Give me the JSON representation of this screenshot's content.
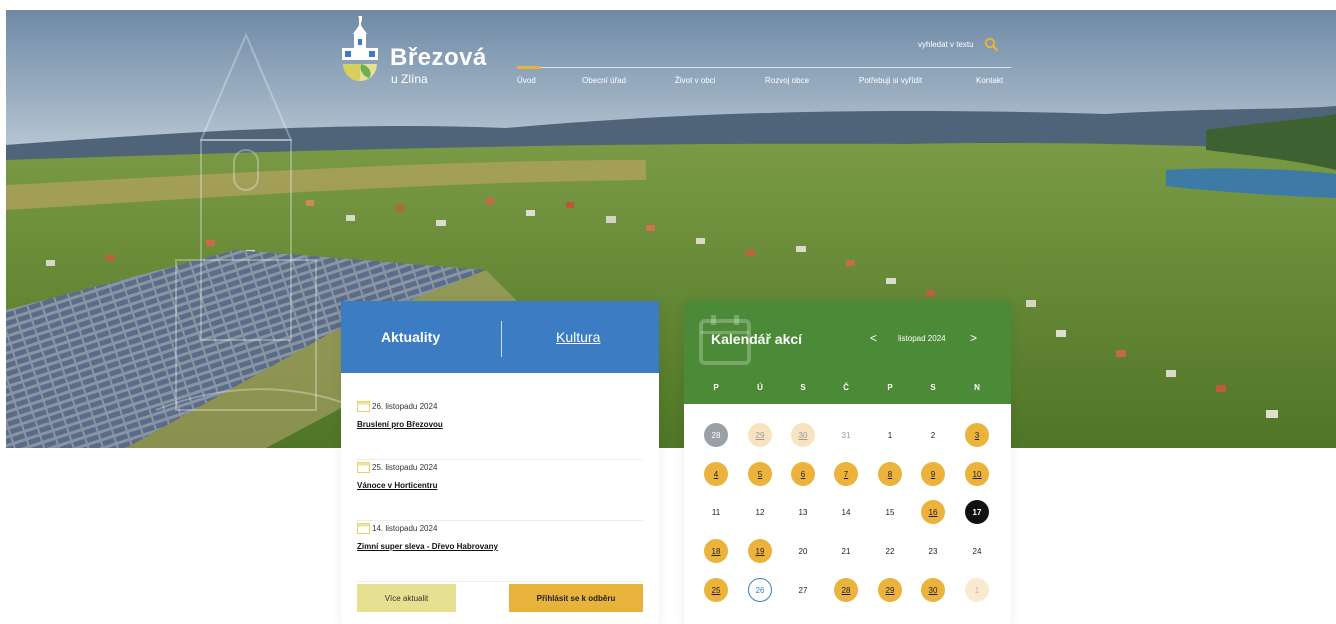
{
  "site": {
    "name": "Březová",
    "subtitle": "u Zlína"
  },
  "search": {
    "label": "vyhledat v textu",
    "icon": "search-icon"
  },
  "nav": [
    {
      "label": "Úvod",
      "active": true
    },
    {
      "label": "Obecní úřad"
    },
    {
      "label": "Život v obci"
    },
    {
      "label": "Rozvoj obce"
    },
    {
      "label": "Potřebuji si vyřídit"
    },
    {
      "label": "Kontakt"
    }
  ],
  "news": {
    "tabs": [
      "Aktuality",
      "Kultura"
    ],
    "items": [
      {
        "date": "26. listopadu 2024",
        "title": "Bruslení pro Březovou"
      },
      {
        "date": "25. listopadu 2024",
        "title": "Vánoce v Horticentru"
      },
      {
        "date": "14. listopadu 2024",
        "title": "Zimní super sleva - Dřevo Habrovany"
      }
    ],
    "more_label": "Více aktualit",
    "subscribe_label": "Přihlásit se k odběru"
  },
  "calendar": {
    "title": "Kalendář akcí",
    "month": "listopad 2024",
    "prev": "<",
    "next": ">",
    "weekdays": [
      "P",
      "Ú",
      "S",
      "Č",
      "P",
      "S",
      "N"
    ],
    "weeks": [
      [
        {
          "d": "28",
          "s": "prev-out"
        },
        {
          "d": "29",
          "s": "ev-muted"
        },
        {
          "d": "30",
          "s": "ev-muted"
        },
        {
          "d": "31",
          "s": "muted"
        },
        {
          "d": "1",
          "s": ""
        },
        {
          "d": "2",
          "s": ""
        },
        {
          "d": "3",
          "s": "ev"
        }
      ],
      [
        {
          "d": "4",
          "s": "ev"
        },
        {
          "d": "5",
          "s": "ev"
        },
        {
          "d": "6",
          "s": "ev"
        },
        {
          "d": "7",
          "s": "ev"
        },
        {
          "d": "8",
          "s": "ev"
        },
        {
          "d": "9",
          "s": "ev"
        },
        {
          "d": "10",
          "s": "ev"
        }
      ],
      [
        {
          "d": "11",
          "s": ""
        },
        {
          "d": "12",
          "s": ""
        },
        {
          "d": "13",
          "s": ""
        },
        {
          "d": "14",
          "s": ""
        },
        {
          "d": "15",
          "s": ""
        },
        {
          "d": "16",
          "s": "ev"
        },
        {
          "d": "17",
          "s": "today"
        }
      ],
      [
        {
          "d": "18",
          "s": "ev"
        },
        {
          "d": "19",
          "s": "ev"
        },
        {
          "d": "20",
          "s": ""
        },
        {
          "d": "21",
          "s": ""
        },
        {
          "d": "22",
          "s": ""
        },
        {
          "d": "23",
          "s": ""
        },
        {
          "d": "24",
          "s": ""
        }
      ],
      [
        {
          "d": "25",
          "s": "ev"
        },
        {
          "d": "26",
          "s": "selected"
        },
        {
          "d": "27",
          "s": ""
        },
        {
          "d": "28",
          "s": "ev"
        },
        {
          "d": "29",
          "s": "ev"
        },
        {
          "d": "30",
          "s": "ev"
        },
        {
          "d": "1",
          "s": "fade"
        }
      ]
    ]
  },
  "colors": {
    "news_blue": "#3c7cc3",
    "calendar_green": "#4b8a37",
    "event_yellow": "#ebb23c",
    "more_button": "#e6e092",
    "subscribe_button": "#e7b33a"
  }
}
